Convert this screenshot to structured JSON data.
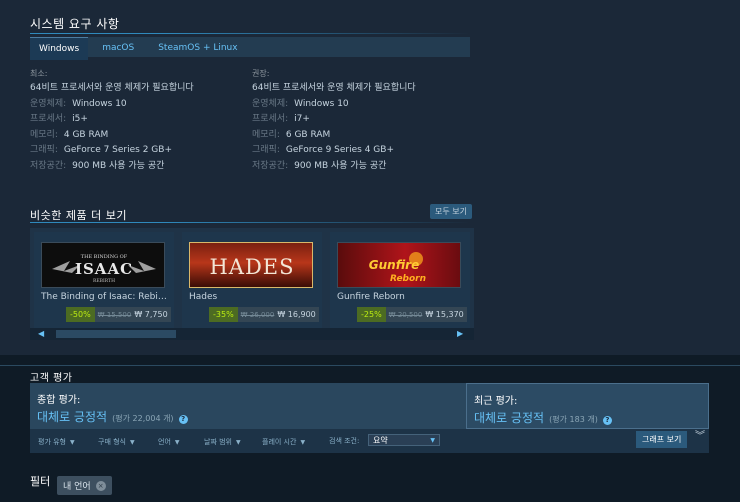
{
  "sysreq": {
    "title": "시스템 요구 사항",
    "tabs": [
      "Windows",
      "macOS",
      "SteamOS + Linux"
    ],
    "min": {
      "header": "최소:",
      "line1": "64비트 프로세서와 운영 체제가 필요합니다",
      "os_k": "운영체제:",
      "os_v": "Windows 10",
      "cpu_k": "프로세서:",
      "cpu_v": "i5+",
      "mem_k": "메모리:",
      "mem_v": "4 GB RAM",
      "gpu_k": "그래픽:",
      "gpu_v": "GeForce 7 Series 2 GB+",
      "disk_k": "저장공간:",
      "disk_v": "900 MB 사용 가능 공간"
    },
    "rec": {
      "header": "권장:",
      "line1": "64비트 프로세서와 운영 체제가 필요합니다",
      "os_k": "운영체제:",
      "os_v": "Windows 10",
      "cpu_k": "프로세서:",
      "cpu_v": "i7+",
      "mem_k": "메모리:",
      "mem_v": "6 GB RAM",
      "gpu_k": "그래픽:",
      "gpu_v": "GeForce 9 Series 4 GB+",
      "disk_k": "저장공간:",
      "disk_v": "900 MB 사용 가능 공간"
    }
  },
  "similar": {
    "title": "비슷한 제품 더 보기",
    "see_all": "모두 보기",
    "items": [
      {
        "name": "The Binding of Isaac: Rebi…",
        "logo_top": "THE BINDING OF",
        "logo": "ISAAC",
        "logo_sub": "REBIRTH",
        "discount": "-50%",
        "old": "₩ 15,500",
        "new": "₩ 7,750"
      },
      {
        "name": "Hades",
        "logo": "HADES",
        "discount": "-35%",
        "old": "₩ 26,000",
        "new": "₩ 16,900"
      },
      {
        "name": "Gunfire Reborn",
        "logo": "Gunfire",
        "logo_sub": "Reborn",
        "discount": "-25%",
        "old": "₩ 20,500",
        "new": "₩ 15,370"
      }
    ],
    "arrow_left": "◀",
    "arrow_right": "▶"
  },
  "reviews": {
    "title": "고객 평가",
    "overall_label": "종합 평가:",
    "overall_score": "대체로 긍정적",
    "overall_count": "(평가 22,004 개)",
    "recent_label": "최근 평가:",
    "recent_score": "대체로 긍정적",
    "recent_count": "(평가 183 개)",
    "help": "?",
    "filters": [
      "평가 유형",
      "구매 형식",
      "언어",
      "날짜 범위",
      "플레이 시간"
    ],
    "display_label": "검색 조건:",
    "display_value": "요약",
    "graph_btn": "그래프 보기",
    "filter_title": "필터",
    "chip": "내 언어",
    "chip_x": "×"
  }
}
